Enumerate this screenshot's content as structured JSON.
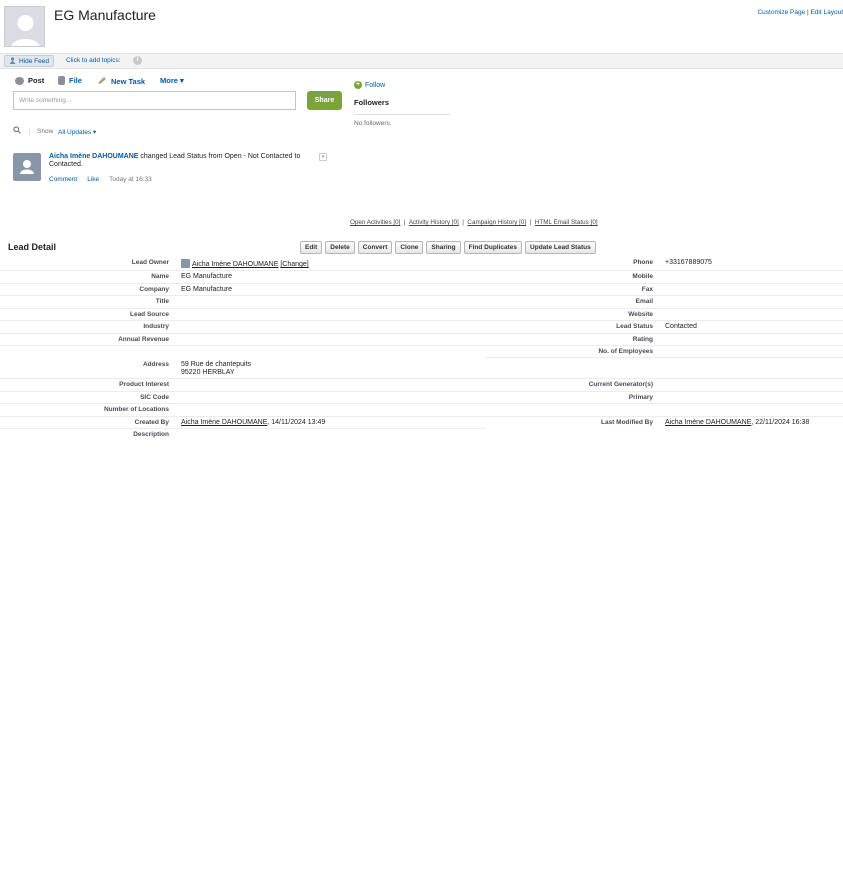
{
  "header": {
    "title": "EG Manufacture",
    "links": "Customize Page | Edit Layout"
  },
  "feed_bar": {
    "hide_feed": "Hide Feed",
    "add_topics": "Click to add topics:"
  },
  "publisher": {
    "post": "Post",
    "file": "File",
    "new_task": "New Task",
    "more": "More ▾",
    "placeholder": "Write something...",
    "share": "Share"
  },
  "followers": {
    "follow": "Follow",
    "title": "Followers",
    "empty": "No followers."
  },
  "filter": {
    "sep": "|",
    "show": "Show",
    "value": "All Updates ▾"
  },
  "feed_item": {
    "author": "Aicha Imène DAHOUMANE",
    "text": " changed Lead Status from Open - Not Contacted to Contacted.",
    "comment": "Comment",
    "like": "Like",
    "time": "Today at 16:33"
  },
  "related": {
    "open_activities": "Open Activities [0]",
    "activity_history": "Activity History [0]",
    "campaign_history": "Campaign History [0]",
    "html_email": "HTML Email Status [0]",
    "sep": "|"
  },
  "lead_detail": {
    "title": "Lead Detail",
    "buttons": {
      "edit": "Edit",
      "delete": "Delete",
      "convert": "Convert",
      "clone": "Clone",
      "sharing": "Sharing",
      "find_duplicates": "Find Duplicates",
      "update_status": "Update Lead Status"
    },
    "left": {
      "lead_owner": {
        "label": "Lead Owner",
        "value": "Aicha Imène DAHOUMANE",
        "change": "[Change]"
      },
      "name": {
        "label": "Name",
        "value": "EG Manufacture"
      },
      "company": {
        "label": "Company",
        "value": "EG Manufacture"
      },
      "title": {
        "label": "Title",
        "value": ""
      },
      "lead_source": {
        "label": "Lead Source",
        "value": ""
      },
      "industry": {
        "label": "Industry",
        "value": ""
      },
      "annual_revenue": {
        "label": "Annual Revenue",
        "value": ""
      },
      "address": {
        "label": "Address",
        "line1": "59 Rue de chantepuits",
        "line2": "95220 HERBLAY"
      },
      "product_interest": {
        "label": "Product Interest",
        "value": ""
      },
      "sic_code": {
        "label": "SIC Code",
        "value": ""
      },
      "num_locations": {
        "label": "Number of Locations",
        "value": ""
      },
      "created_by": {
        "label": "Created By",
        "user": "Aicha Imène DAHOUMANE",
        "date": ", 14/11/2024 13:49"
      },
      "description": {
        "label": "Description",
        "value": ""
      }
    },
    "right": {
      "phone": {
        "label": "Phone",
        "value": "+33167889075"
      },
      "mobile": {
        "label": "Mobile",
        "value": ""
      },
      "fax": {
        "label": "Fax",
        "value": ""
      },
      "email": {
        "label": "Email",
        "value": ""
      },
      "website": {
        "label": "Website",
        "value": ""
      },
      "lead_status": {
        "label": "Lead Status",
        "value": "Contacted"
      },
      "rating": {
        "label": "Rating",
        "value": ""
      },
      "num_employees": {
        "label": "No. of Employees",
        "value": ""
      },
      "current_generators": {
        "label": "Current Generator(s)",
        "value": ""
      },
      "primary": {
        "label": "Primary",
        "value": ""
      },
      "last_modified_by": {
        "label": "Last Modified By",
        "user": "Aicha Imène DAHOUMANE",
        "date": ", 22/11/2024 16:38"
      }
    }
  }
}
